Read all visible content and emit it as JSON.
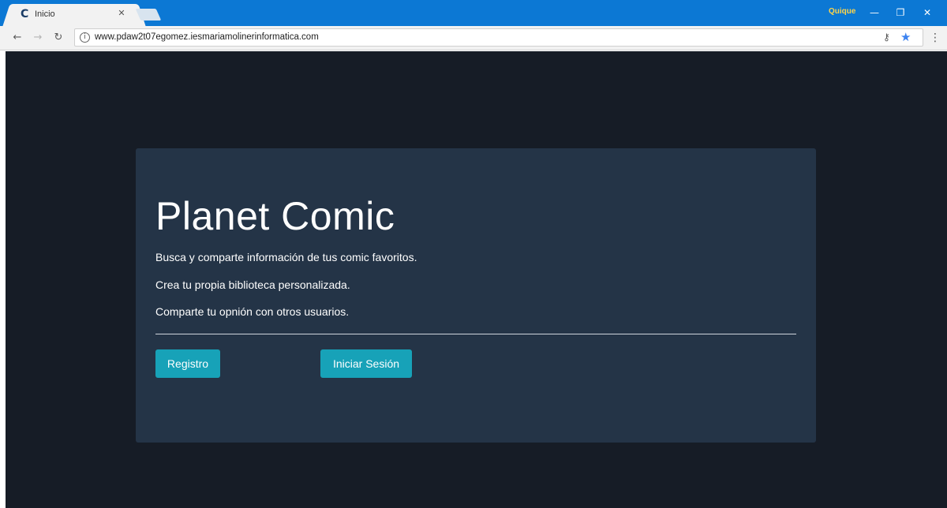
{
  "browser": {
    "tab_title": "Inicio",
    "tab_favicon": "C",
    "profile_name": "Quique",
    "url": "www.pdaw2t07egomez.iesmariamolinerinformatica.com",
    "accent_color": "#0c78d4"
  },
  "page": {
    "title": "Planet Comic",
    "lines": [
      "Busca y comparte información de tus comic favoritos.",
      "Crea tu propia biblioteca personalizada.",
      "Comparte tu opnión con otros usuarios."
    ],
    "buttons": {
      "register_label": "Registro",
      "login_label": "Iniciar Sesión"
    },
    "background_color": "#161c26",
    "panel_color": "#243447",
    "button_color": "#17a2b8"
  },
  "icons": [
    "back-arrow-icon",
    "forward-arrow-icon",
    "reload-icon",
    "info-icon",
    "key-icon",
    "star-icon",
    "menu-icon",
    "close-icon",
    "minimize-icon",
    "maximize-icon"
  ]
}
